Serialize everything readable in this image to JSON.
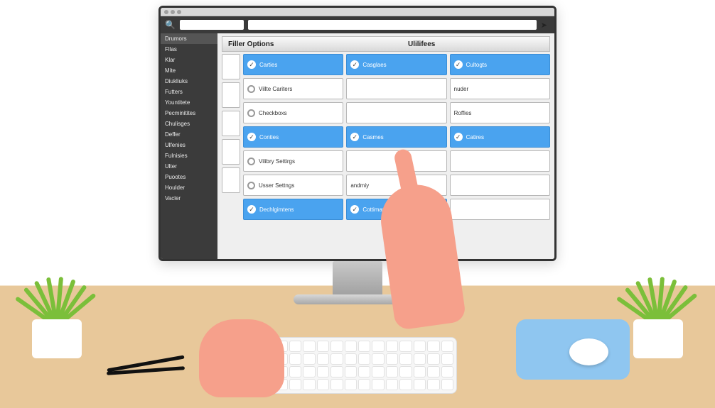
{
  "panel": {
    "title_left": "Filler Options",
    "title_right": "Ulilifees"
  },
  "sidebar": {
    "items": [
      {
        "label": "Drumors"
      },
      {
        "label": "Fllas"
      },
      {
        "label": "Klar"
      },
      {
        "label": "Mite"
      },
      {
        "label": "Diukliuks"
      },
      {
        "label": "Futters"
      },
      {
        "label": "Yountitete"
      },
      {
        "label": "Pecminitites"
      },
      {
        "label": "Chulisges"
      },
      {
        "label": "Deffer"
      },
      {
        "label": "Ulfenies"
      },
      {
        "label": "Fulnisies"
      },
      {
        "label": "Ulter"
      },
      {
        "label": "Puootes"
      },
      {
        "label": "Houlder"
      },
      {
        "label": "Vacler"
      }
    ]
  },
  "cards": [
    {
      "state": "checked",
      "style": "blue",
      "label": "Carties"
    },
    {
      "state": "checked",
      "style": "blue",
      "label": "Casglaes"
    },
    {
      "state": "checked",
      "style": "blue",
      "label": "Cultogts"
    },
    {
      "state": "radio",
      "style": "white",
      "label": "Villte Cariters"
    },
    {
      "state": "none",
      "style": "white",
      "label": ""
    },
    {
      "state": "none",
      "style": "white",
      "label": "nuder"
    },
    {
      "state": "radio",
      "style": "white",
      "label": "Checkboxs"
    },
    {
      "state": "none",
      "style": "white",
      "label": ""
    },
    {
      "state": "none",
      "style": "white",
      "label": "Roffies"
    },
    {
      "state": "checked",
      "style": "blue",
      "label": "Conties"
    },
    {
      "state": "checked",
      "style": "blue",
      "label": "Casmes"
    },
    {
      "state": "checked",
      "style": "blue",
      "label": "Catires"
    },
    {
      "state": "radio",
      "style": "white",
      "label": "Vilibry Settirgs"
    },
    {
      "state": "none",
      "style": "white",
      "label": ""
    },
    {
      "state": "none",
      "style": "white",
      "label": ""
    },
    {
      "state": "radio",
      "style": "white",
      "label": "Usser Settngs"
    },
    {
      "state": "none",
      "style": "white",
      "label": "andmiy"
    },
    {
      "state": "none",
      "style": "white",
      "label": ""
    },
    {
      "state": "checked",
      "style": "blue",
      "label": "Dechlgimtens"
    },
    {
      "state": "checked",
      "style": "blue",
      "label": "Cottimanies"
    },
    {
      "state": "none",
      "style": "white",
      "label": ""
    }
  ]
}
